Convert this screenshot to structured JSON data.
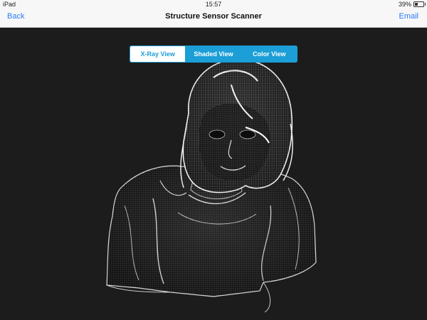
{
  "status_bar": {
    "device": "iPad",
    "time": "15:57",
    "battery": "39%",
    "battery_level": 0.39
  },
  "nav": {
    "back_label": "Back",
    "title": "Structure Sensor Scanner",
    "email_label": "Email"
  },
  "view_modes": {
    "items": [
      {
        "label": "X-Ray View",
        "selected": false
      },
      {
        "label": "Shaded View",
        "selected": true
      },
      {
        "label": "Color View",
        "selected": true
      }
    ]
  },
  "colors": {
    "accent": "#1c9ed6",
    "link": "#2a7cf6",
    "viewport_bg": "#1c1c1c"
  }
}
